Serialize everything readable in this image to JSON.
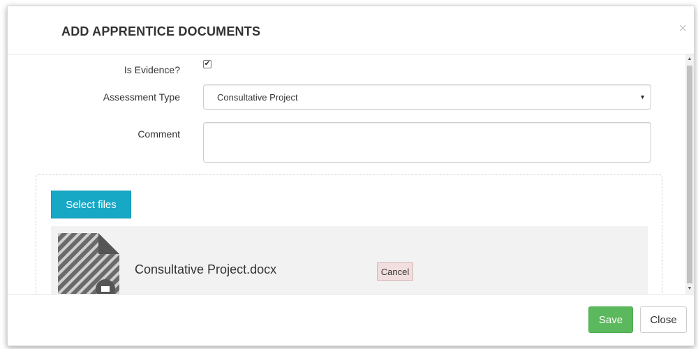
{
  "modal": {
    "title": "ADD APPRENTICE DOCUMENTS",
    "close_symbol": "×"
  },
  "form": {
    "is_evidence": {
      "label": "Is Evidence?",
      "checked": true,
      "check_glyph": "✔"
    },
    "assessment_type": {
      "label": "Assessment Type",
      "value": "Consultative Project",
      "arrow": "▼"
    },
    "comment": {
      "label": "Comment",
      "value": ""
    }
  },
  "upload": {
    "select_files_label": "Select files",
    "file": {
      "name": "Consultative Project.docx",
      "cancel_label": "Cancel",
      "icon": "document-icon"
    }
  },
  "scrollbar": {
    "up_arrow": "▲",
    "down_arrow": "▼"
  },
  "footer": {
    "save_label": "Save",
    "close_label": "Close"
  },
  "colors": {
    "select_files_bg": "#17a8c6",
    "save_bg": "#5cb85c",
    "cancel_bg": "#f2dede"
  }
}
